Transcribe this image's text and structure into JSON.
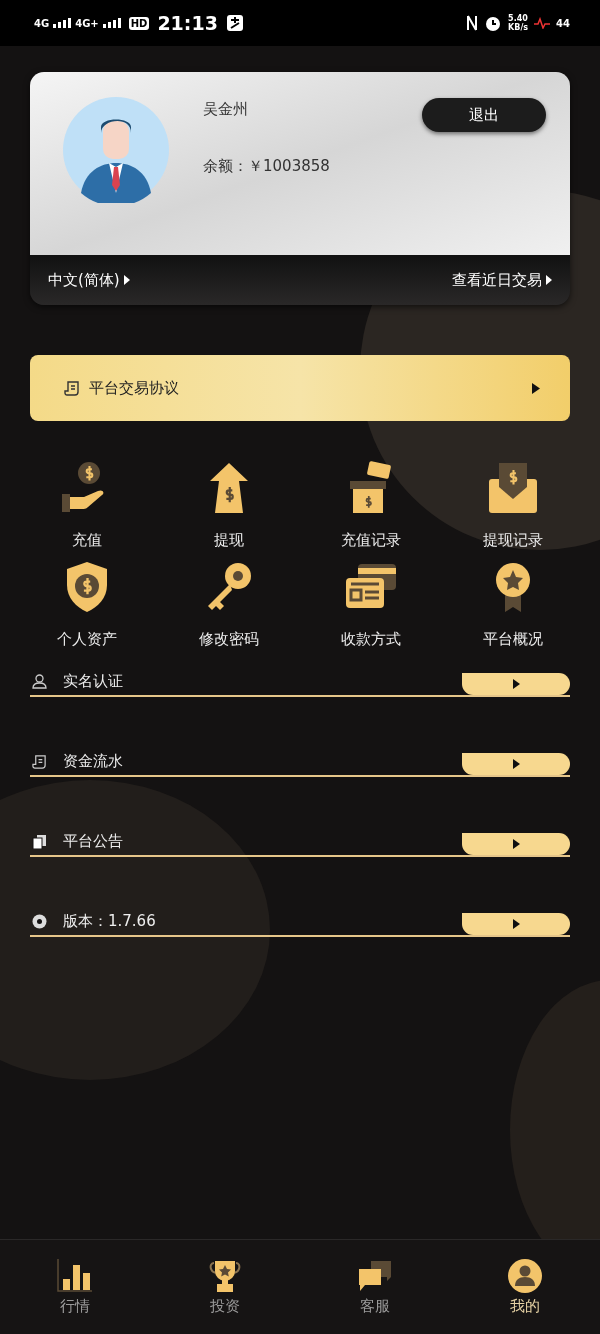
{
  "status_bar": {
    "network_1": "4G",
    "network_2": "4G+",
    "hd": "HD",
    "time": "21:13",
    "speed": "5.40",
    "speed_unit": "KB/s",
    "battery": "44"
  },
  "profile": {
    "name": "吴金州",
    "balance": "余额：￥1003858",
    "logout": "退出",
    "language": "中文(简体)",
    "recent_trades": "查看近日交易"
  },
  "agreement": {
    "label": "平台交易协议"
  },
  "shortcuts": [
    {
      "label": "充值",
      "kind": "hand-coin"
    },
    {
      "label": "提现",
      "kind": "arrow-up"
    },
    {
      "label": "充值记录",
      "kind": "box"
    },
    {
      "label": "提现记录",
      "kind": "envelope"
    },
    {
      "label": "个人资产",
      "kind": "shield"
    },
    {
      "label": "修改密码",
      "kind": "key"
    },
    {
      "label": "收款方式",
      "kind": "cards"
    },
    {
      "label": "平台概况",
      "kind": "medal"
    }
  ],
  "menu": [
    {
      "label": "实名认证",
      "kind": "person"
    },
    {
      "label": "资金流水",
      "kind": "doc"
    },
    {
      "label": "平台公告",
      "kind": "files"
    },
    {
      "label": "版本：1.7.66",
      "kind": "disc"
    }
  ],
  "tabs": [
    {
      "label": "行情",
      "kind": "bars",
      "selected": false
    },
    {
      "label": "投资",
      "kind": "trophy",
      "selected": false
    },
    {
      "label": "客服",
      "kind": "chat",
      "selected": false
    },
    {
      "label": "我的",
      "kind": "user",
      "selected": true
    }
  ]
}
